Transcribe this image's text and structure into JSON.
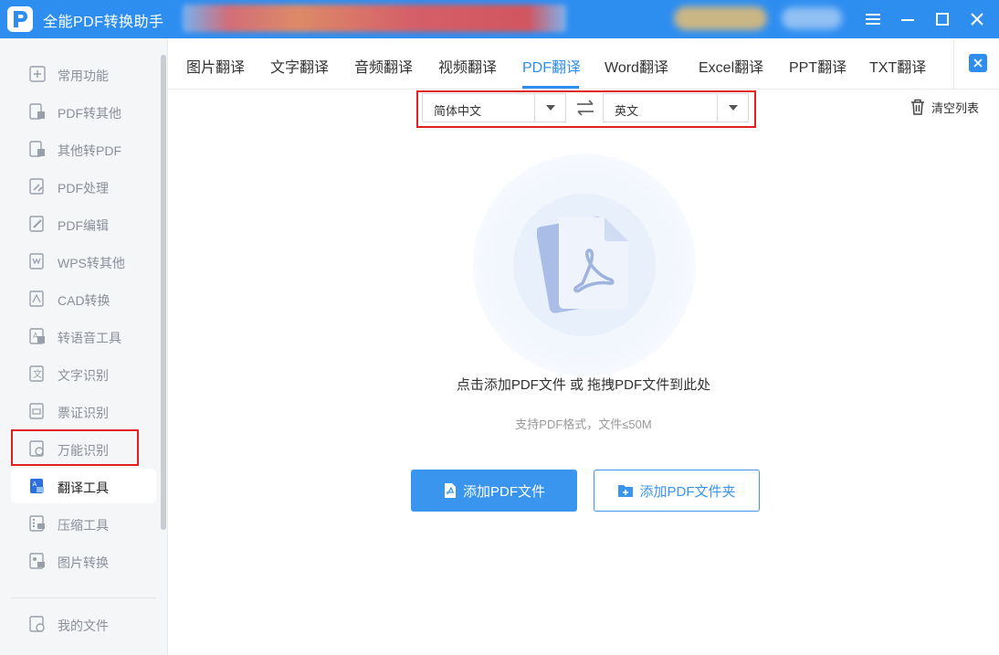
{
  "app": {
    "title": "全能PDF转换助手",
    "icons": {
      "logo": "pdf-logo-icon",
      "menu": "menu-icon",
      "minimize": "minimize-icon",
      "maximize": "maximize-icon",
      "close": "close-icon"
    }
  },
  "sidebar": {
    "items": [
      {
        "label": "常用功能",
        "icon": "grid-plus-icon"
      },
      {
        "label": "PDF转其他",
        "icon": "pdf-export-icon"
      },
      {
        "label": "其他转PDF",
        "icon": "pdf-import-icon"
      },
      {
        "label": "PDF处理",
        "icon": "pdf-process-icon"
      },
      {
        "label": "PDF编辑",
        "icon": "pdf-edit-icon"
      },
      {
        "label": "WPS转其他",
        "icon": "wps-icon"
      },
      {
        "label": "CAD转换",
        "icon": "cad-icon"
      },
      {
        "label": "转语音工具",
        "icon": "voice-icon"
      },
      {
        "label": "文字识别",
        "icon": "text-recognition-icon"
      },
      {
        "label": "票证识别",
        "icon": "ticket-recognition-icon"
      },
      {
        "label": "万能识别",
        "icon": "universal-recognition-icon"
      },
      {
        "label": "翻译工具",
        "icon": "translate-icon"
      },
      {
        "label": "压缩工具",
        "icon": "compress-icon"
      },
      {
        "label": "图片转换",
        "icon": "image-convert-icon"
      }
    ],
    "active_index": 11,
    "footer_item": {
      "label": "我的文件",
      "icon": "my-files-icon"
    }
  },
  "tabs": {
    "items": [
      "图片翻译",
      "文字翻译",
      "音频翻译",
      "视频翻译",
      "PDF翻译",
      "Word翻译",
      "Excel翻译",
      "PPT翻译",
      "TXT翻译"
    ],
    "active_index": 4
  },
  "translate": {
    "source_language": "简体中文",
    "target_language": "英文",
    "swap_icon": "swap-arrows-icon",
    "clear_list_label": "清空列表",
    "clear_icon": "trash-icon"
  },
  "dropzone": {
    "main_text": "点击添加PDF文件 或 拖拽PDF文件到此处",
    "sub_text": "支持PDF格式，文件≤50M",
    "illustration_icon": "pdf-document-icon"
  },
  "buttons": {
    "add_file": "添加PDF文件",
    "add_folder": "添加PDF文件夹"
  },
  "colors": {
    "accent": "#2e8ef0",
    "highlight": "#e02020"
  }
}
